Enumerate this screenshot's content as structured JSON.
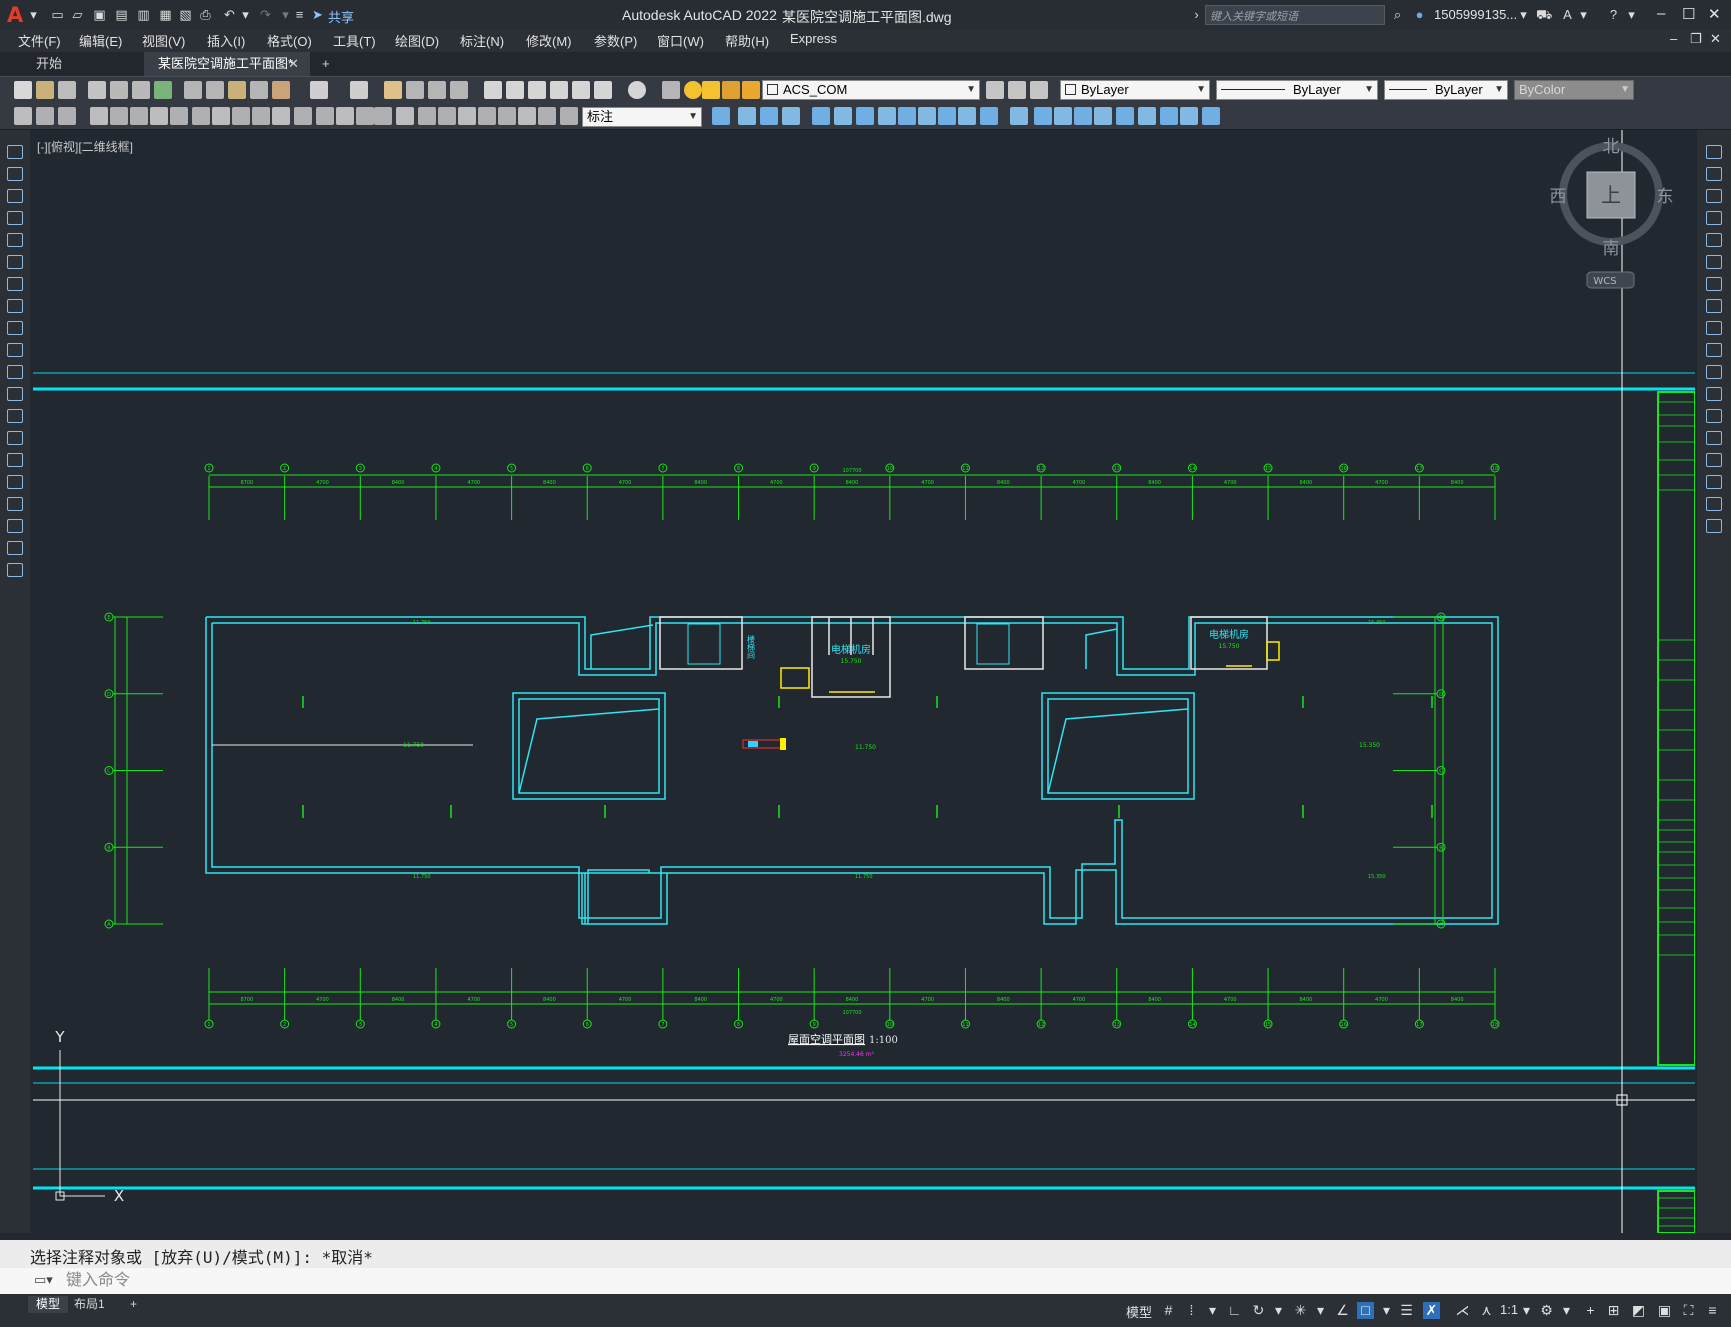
{
  "titlebar": {
    "app": "Autodesk AutoCAD 2022",
    "file": "某医院空调施工平面图.dwg",
    "share": "共享",
    "search_placeholder": "键入关键字或短语",
    "user": "1505999135..."
  },
  "menu": [
    "文件(F)",
    "编辑(E)",
    "视图(V)",
    "插入(I)",
    "格式(O)",
    "工具(T)",
    "绘图(D)",
    "标注(N)",
    "修改(M)",
    "参数(P)",
    "窗口(W)",
    "帮助(H)",
    "Express"
  ],
  "tabs": [
    "开始",
    "某医院空调施工平面图*"
  ],
  "toolbar": {
    "layer": "ACS_COM",
    "color": "ByLayer",
    "linetype": "ByLayer",
    "lineweight": "ByLayer",
    "plotstyle": "ByColor",
    "dimstyle": "标注"
  },
  "viewport": {
    "label": "[-][俯视][二维线框]",
    "viewcube": {
      "north": "北",
      "south": "南",
      "east": "东",
      "west": "西",
      "face": "上",
      "wcs": "WCS"
    },
    "ucs": {
      "x": "X",
      "y": "Y"
    }
  },
  "drawing": {
    "title": "屋面空调平面图",
    "scale": "1:100",
    "area": "3254.46 m²",
    "columns": [
      "1",
      "2",
      "3",
      "4",
      "5",
      "6",
      "7",
      "8",
      "9",
      "10",
      "11",
      "12",
      "13",
      "14",
      "15",
      "16",
      "17",
      "18"
    ],
    "rows": [
      "E",
      "D",
      "C",
      "B",
      "A"
    ],
    "spans": [
      "8700",
      "4700",
      "8400",
      "4700",
      "8400",
      "4700",
      "8400",
      "4700",
      "8400",
      "4700",
      "8400",
      "4700",
      "8400",
      "4700",
      "8400",
      "4700",
      "8400"
    ],
    "total": "107700",
    "room_elevator": "电梯机房",
    "room_elevator_level": "15.750",
    "roof_level": "11.750",
    "roof_level_right": "15.350",
    "stair": "楼梯间"
  },
  "command": {
    "history": "选择注释对象或 [放弃(U)/模式(M)]: *取消*",
    "placeholder": "键入命令"
  },
  "status": {
    "tabs": [
      "模型",
      "布局1"
    ],
    "mode": "模型",
    "scale": "1:1"
  }
}
